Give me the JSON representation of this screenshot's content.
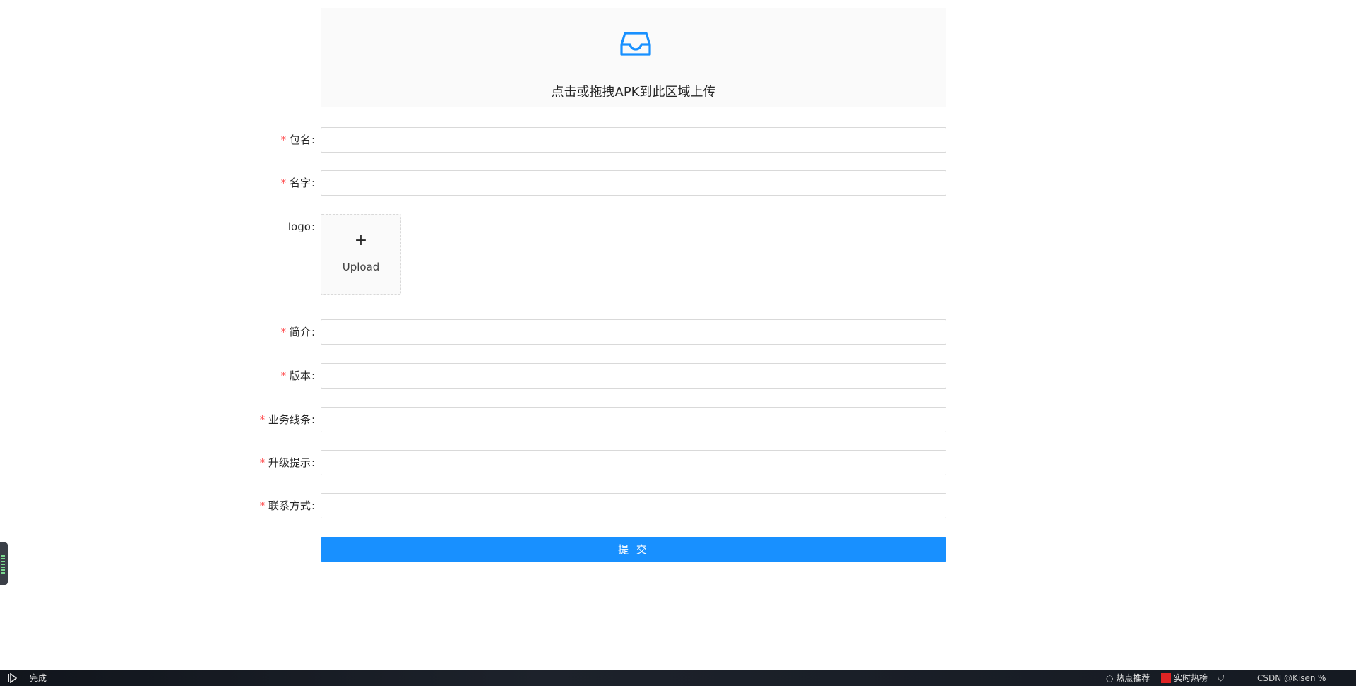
{
  "upload_area": {
    "hint": "点击或拖拽APK到此区域上传",
    "icon": "inbox-icon",
    "accent": "#1890ff"
  },
  "form": {
    "required_mark": "*",
    "colon": ":",
    "fields": {
      "package_name": {
        "label": "包名"
      },
      "name": {
        "label": "名字"
      },
      "logo": {
        "label": "logo",
        "upload_text": "Upload",
        "plus": "+"
      },
      "intro": {
        "label": "简介"
      },
      "version": {
        "label": "版本"
      },
      "business_line": {
        "label": "业务线条"
      },
      "upgrade_tip": {
        "label": "升级提示"
      },
      "contact": {
        "label": "联系方式"
      }
    },
    "submit_label": "提 交"
  },
  "status_bar": {
    "status": "完成",
    "hot_recommend": "热点推荐",
    "realtime_hot": "实时热榜",
    "watermark": "CSDN @Kisen",
    "zoom": "%"
  },
  "colors": {
    "required": "#ff4d4f",
    "primary": "#1890ff",
    "border": "#d9d9d9"
  }
}
